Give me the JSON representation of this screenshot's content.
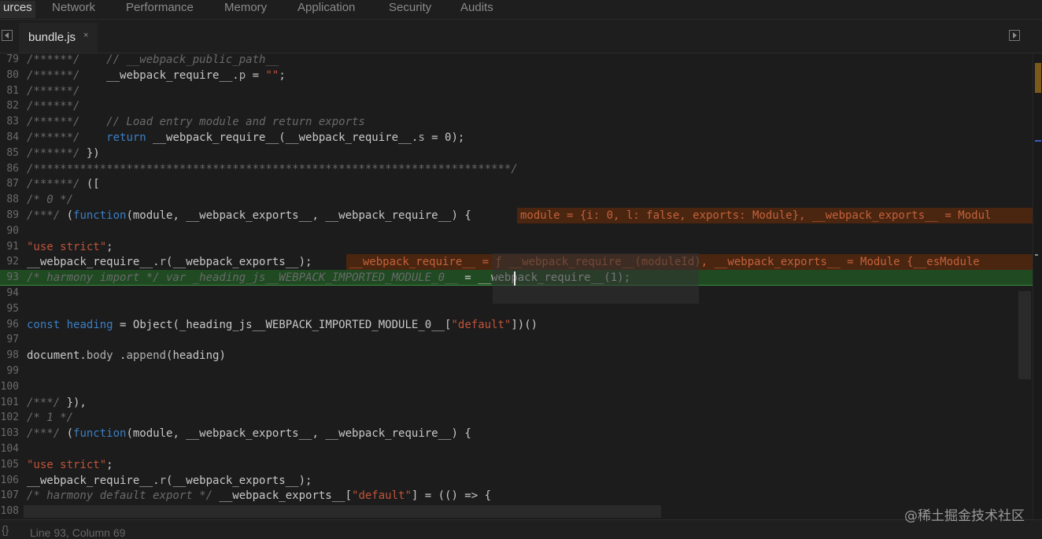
{
  "tabs": [
    "urces",
    "Network",
    "Performance",
    "Memory",
    "Application",
    "Security",
    "Audits"
  ],
  "file_tab": {
    "name": "bundle.js",
    "close": "×"
  },
  "lines": [
    {
      "n": "79",
      "segs": [
        [
          "c-com",
          "/******/    // __webpack_public_path__"
        ]
      ]
    },
    {
      "n": "80",
      "segs": [
        [
          "c-com",
          "/******/    "
        ],
        [
          "",
          "__webpack_require__."
        ],
        [
          "c-prop",
          "p"
        ],
        [
          "",
          " = "
        ],
        [
          "c-str",
          "\"\""
        ],
        [
          "",
          ";"
        ]
      ]
    },
    {
      "n": "81",
      "segs": [
        [
          "c-com",
          "/******/"
        ]
      ]
    },
    {
      "n": "82",
      "segs": [
        [
          "c-com",
          "/******/"
        ]
      ]
    },
    {
      "n": "83",
      "segs": [
        [
          "c-com",
          "/******/    // Load entry module and return exports"
        ]
      ]
    },
    {
      "n": "84",
      "segs": [
        [
          "c-com",
          "/******/    "
        ],
        [
          "c-kw",
          "return"
        ],
        [
          "",
          " __webpack_require__(__webpack_require__."
        ],
        [
          "c-prop",
          "s"
        ],
        [
          "",
          " = 0);"
        ]
      ]
    },
    {
      "n": "85",
      "segs": [
        [
          "c-com",
          "/******/ "
        ],
        [
          "",
          "})"
        ]
      ]
    },
    {
      "n": "86",
      "segs": [
        [
          "c-com",
          "/************************************************************************/"
        ]
      ]
    },
    {
      "n": "87",
      "segs": [
        [
          "c-com",
          "/******/ "
        ],
        [
          "",
          "(["
        ]
      ]
    },
    {
      "n": "88",
      "segs": [
        [
          "c-com",
          "/* 0 */"
        ]
      ]
    },
    {
      "n": "89",
      "segs": [
        [
          "c-com",
          "/***/ "
        ],
        [
          "",
          "("
        ],
        [
          "c-kw",
          "function"
        ],
        [
          "",
          "(module, __webpack_exports__, __webpack_require__) {"
        ]
      ]
    },
    {
      "n": "90",
      "segs": []
    },
    {
      "n": "91",
      "segs": [
        [
          "c-str",
          "\"use strict\""
        ],
        [
          "",
          ";"
        ]
      ]
    },
    {
      "n": "92",
      "segs": [
        [
          "",
          "__webpack_require__."
        ],
        [
          "c-prop",
          "r"
        ],
        [
          "",
          "(__webpack_exports__);"
        ]
      ]
    },
    {
      "n": "93",
      "segs": [
        [
          "c-com",
          "/* harmony import */ var _heading_js__WEBPACK_IMPORTED_MODULE_0__"
        ],
        [
          "",
          " = __webpack_require__(1);"
        ]
      ],
      "exec": true
    },
    {
      "n": "94",
      "segs": []
    },
    {
      "n": "95",
      "segs": []
    },
    {
      "n": "96",
      "segs": [
        [
          "c-kw",
          "const"
        ],
        [
          "",
          " "
        ],
        [
          "c-kw",
          "heading"
        ],
        [
          "",
          " = Object(_heading_js__WEBPACK_IMPORTED_MODULE_0__["
        ],
        [
          "c-str",
          "\"default\""
        ],
        [
          "",
          "])()"
        ]
      ]
    },
    {
      "n": "97",
      "segs": []
    },
    {
      "n": "98",
      "segs": [
        [
          "",
          "document."
        ],
        [
          "c-prop",
          "body"
        ],
        [
          "",
          " ."
        ],
        [
          "c-prop",
          "append"
        ],
        [
          "",
          "(heading)"
        ]
      ]
    },
    {
      "n": "99",
      "segs": []
    },
    {
      "n": "100",
      "segs": []
    },
    {
      "n": "101",
      "segs": [
        [
          "c-com",
          "/***/ "
        ],
        [
          "",
          "}),"
        ]
      ]
    },
    {
      "n": "102",
      "segs": [
        [
          "c-com",
          "/* 1 */"
        ]
      ]
    },
    {
      "n": "103",
      "segs": [
        [
          "c-com",
          "/***/ "
        ],
        [
          "",
          "("
        ],
        [
          "c-kw",
          "function"
        ],
        [
          "",
          "(module, __webpack_exports__, __webpack_require__) {"
        ]
      ]
    },
    {
      "n": "104",
      "segs": []
    },
    {
      "n": "105",
      "segs": [
        [
          "c-str",
          "\"use strict\""
        ],
        [
          "",
          ";"
        ]
      ]
    },
    {
      "n": "106",
      "segs": [
        [
          "",
          "__webpack_require__."
        ],
        [
          "c-prop",
          "r"
        ],
        [
          "",
          "(__webpack_exports__);"
        ]
      ]
    },
    {
      "n": "107",
      "segs": [
        [
          "c-com",
          "/* harmony default export */ "
        ],
        [
          "",
          "__webpack_exports__["
        ],
        [
          "c-str",
          "\"default\""
        ],
        [
          "",
          "] = (() => {"
        ]
      ]
    },
    {
      "n": "108",
      "segs": []
    }
  ],
  "inline_values": {
    "l89": "module = {i: 0, l: false, exports: Module}, __webpack_exports__ = Modul",
    "l92": "__webpack_require__ = ƒ __webpack_require__(moduleId), __webpack_exports__ = Module {__esModule"
  },
  "status": {
    "brace": "{}",
    "position": "Line 93, Column 69"
  },
  "watermark": "@稀土掘金技术社区"
}
